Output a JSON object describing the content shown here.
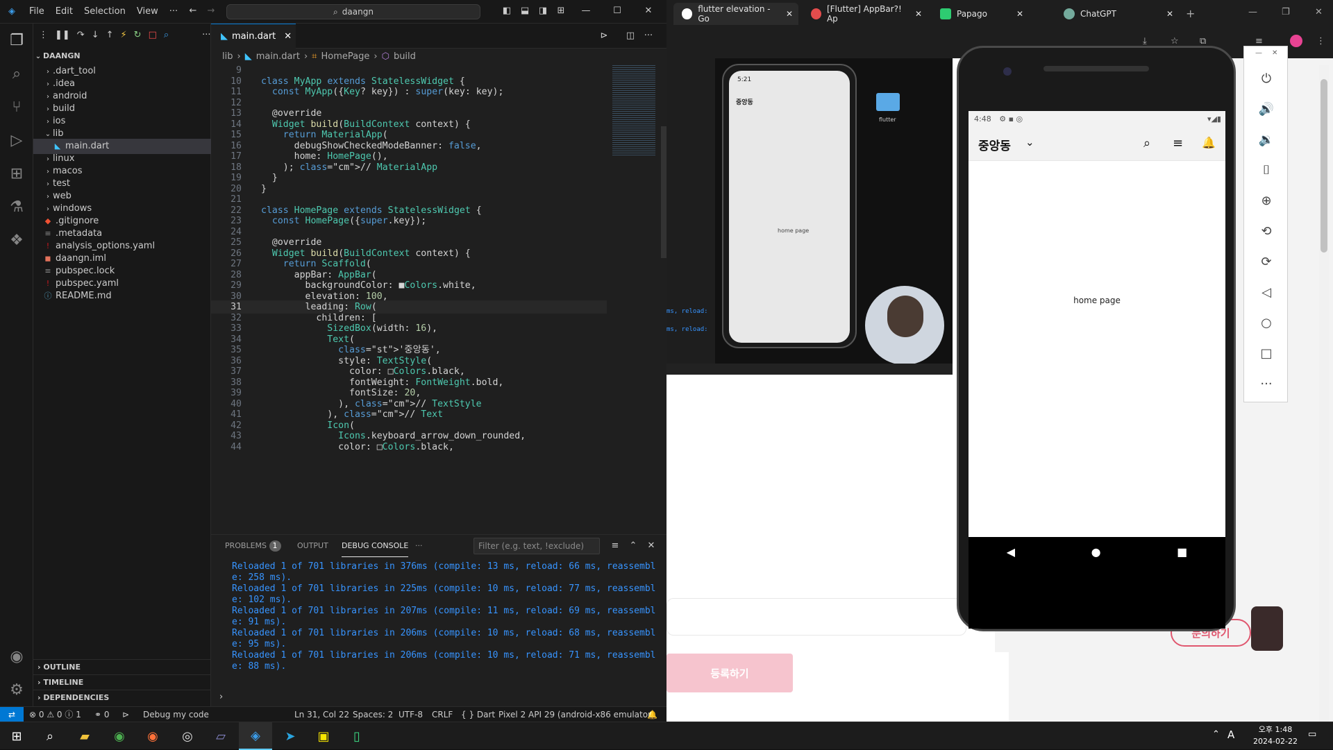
{
  "vscode": {
    "menu": [
      "File",
      "Edit",
      "Selection",
      "View",
      "···"
    ],
    "search": "daangn",
    "sidebar": {
      "root": "DAANGN",
      "items": [
        {
          "label": ".dart_tool",
          "type": "folder"
        },
        {
          "label": ".idea",
          "type": "folder"
        },
        {
          "label": "android",
          "type": "folder"
        },
        {
          "label": "build",
          "type": "folder"
        },
        {
          "label": "ios",
          "type": "folder"
        },
        {
          "label": "lib",
          "type": "folder-open"
        },
        {
          "label": "main.dart",
          "type": "dart"
        },
        {
          "label": "linux",
          "type": "folder"
        },
        {
          "label": "macos",
          "type": "folder"
        },
        {
          "label": "test",
          "type": "folder"
        },
        {
          "label": "web",
          "type": "folder"
        },
        {
          "label": "windows",
          "type": "folder"
        },
        {
          "label": ".gitignore",
          "type": "git"
        },
        {
          "label": ".metadata",
          "type": "file"
        },
        {
          "label": "analysis_options.yaml",
          "type": "yaml"
        },
        {
          "label": "daangn.iml",
          "type": "iml"
        },
        {
          "label": "pubspec.lock",
          "type": "file"
        },
        {
          "label": "pubspec.yaml",
          "type": "yaml"
        },
        {
          "label": "README.md",
          "type": "info"
        }
      ],
      "sections": [
        "OUTLINE",
        "TIMELINE",
        "DEPENDENCIES"
      ]
    },
    "tab": "main.dart",
    "breadcrumb": [
      "lib",
      "main.dart",
      "HomePage",
      "build"
    ],
    "code_first_line": 9,
    "current_line": 31,
    "code": [
      "",
      "class MyApp extends StatelessWidget {",
      "  const MyApp({Key? key}) : super(key: key);",
      "",
      "  @override",
      "  Widget build(BuildContext context) {",
      "    return MaterialApp(",
      "      debugShowCheckedModeBanner: false,",
      "      home: HomePage(),",
      "    ); // MaterialApp",
      "  }",
      "}",
      "",
      "class HomePage extends StatelessWidget {",
      "  const HomePage({super.key});",
      "",
      "  @override",
      "  Widget build(BuildContext context) {",
      "    return Scaffold(",
      "      appBar: AppBar(",
      "        backgroundColor: ■Colors.white,",
      "        elevation: 100,",
      "        leading: Row(",
      "          children: [",
      "            SizedBox(width: 16),",
      "            Text(",
      "              '중앙동',",
      "              style: TextStyle(",
      "                color: □Colors.black,",
      "                fontWeight: FontWeight.bold,",
      "                fontSize: 20,",
      "              ), // TextStyle",
      "            ), // Text",
      "            Icon(",
      "              Icons.keyboard_arrow_down_rounded,",
      "              color: □Colors.black,"
    ],
    "panel": {
      "tabs": [
        "PROBLEMS",
        "OUTPUT",
        "DEBUG CONSOLE",
        "···"
      ],
      "problems_count": "1",
      "filter_placeholder": "Filter (e.g. text, !exclude)",
      "console": [
        "Reloaded 1 of 701 libraries in 376ms (compile: 13 ms, reload: 66 ms, reassembl",
        "e: 258 ms).",
        "Reloaded 1 of 701 libraries in 225ms (compile: 10 ms, reload: 77 ms, reassembl",
        "e: 102 ms).",
        "Reloaded 1 of 701 libraries in 207ms (compile: 11 ms, reload: 69 ms, reassembl",
        "e: 91 ms).",
        "Reloaded 1 of 701 libraries in 206ms (compile: 10 ms, reload: 68 ms, reassembl",
        "e: 95 ms).",
        "Reloaded 1 of 701 libraries in 206ms (compile: 10 ms, reload: 71 ms, reassembl",
        "e: 88 ms)."
      ]
    },
    "status": {
      "errors": "0",
      "warnings": "0",
      "infos": "1",
      "ports": "0",
      "debug": "Debug my code",
      "position": "Ln 31, Col 22",
      "spaces": "Spaces: 2",
      "encoding": "UTF-8",
      "eol": "CRLF",
      "language": "Dart",
      "device": "Pixel 2 API 29 (android-x86 emulator)"
    }
  },
  "browser": {
    "tabs": [
      "flutter elevation - Go",
      "[Flutter] AppBar?! Ap",
      "Papago",
      "ChatGPT"
    ],
    "register_button": "등록하기",
    "inquiry_button": "문의하기",
    "video_title_time": "5:21",
    "video_location": "중앙동",
    "video_home_text": "home page",
    "video_folder": "flutter",
    "video_console": [
      "ms, reload:",
      "ms, reload:"
    ]
  },
  "emulator": {
    "time": "4:48",
    "location": "중앙동",
    "home_text": "home page"
  },
  "taskbar": {
    "time": "오후 1:48",
    "date": "2024-02-22",
    "ime": "A"
  }
}
